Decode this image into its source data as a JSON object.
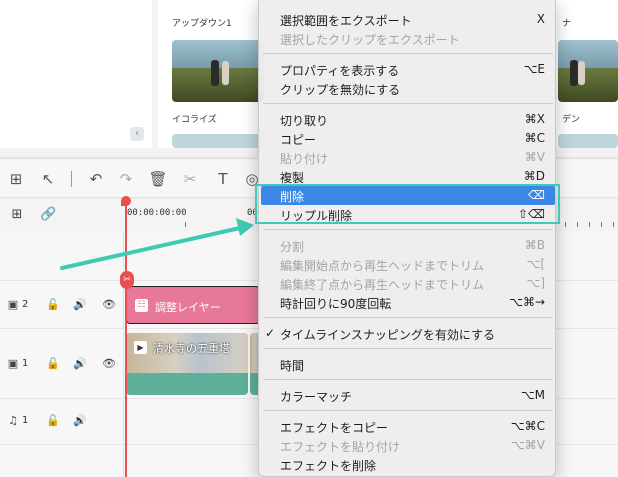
{
  "media": {
    "thumbs": [
      {
        "label": "アップダウン1"
      },
      {
        "label": "イコライズ"
      },
      {
        "label": "ナ"
      },
      {
        "label": "デン"
      }
    ],
    "collapse_glyph": "‹"
  },
  "toolbar": {
    "icons": [
      "grid-icon",
      "pointer-icon",
      "undo-icon",
      "redo-icon",
      "trash-icon",
      "scissors-icon",
      "text-icon",
      "color-icon"
    ]
  },
  "ruler": {
    "start_time": "00:00:00:00",
    "next_time": "00"
  },
  "tracks": [
    {
      "id": "2",
      "kind": "video"
    },
    {
      "id": "1",
      "kind": "video"
    },
    {
      "id": "1",
      "kind": "audio"
    }
  ],
  "clips": {
    "adjustment": "調整レイヤー",
    "video": "清水寺の五重塔"
  },
  "menu": {
    "items": [
      {
        "label": "選択範囲をエクスポート",
        "shortcut": "X",
        "disabled": false
      },
      {
        "label": "選択したクリップをエクスポート",
        "shortcut": "",
        "disabled": true
      },
      {
        "label": "プロパティを表示する",
        "shortcut": "⌥E",
        "disabled": false
      },
      {
        "label": "クリップを無効にする",
        "shortcut": "",
        "disabled": false
      },
      {
        "label": "切り取り",
        "shortcut": "⌘X",
        "disabled": false
      },
      {
        "label": "コピー",
        "shortcut": "⌘C",
        "disabled": false
      },
      {
        "label": "貼り付け",
        "shortcut": "⌘V",
        "disabled": true
      },
      {
        "label": "複製",
        "shortcut": "⌘D",
        "disabled": false
      },
      {
        "label": "削除",
        "shortcut": "⌫",
        "disabled": false
      },
      {
        "label": "リップル削除",
        "shortcut": "⇧⌫",
        "disabled": false
      },
      {
        "label": "分割",
        "shortcut": "⌘B",
        "disabled": true
      },
      {
        "label": "編集開始点から再生ヘッドまでトリム",
        "shortcut": "⌥[",
        "disabled": true
      },
      {
        "label": "編集終了点から再生ヘッドまでトリム",
        "shortcut": "⌥]",
        "disabled": true
      },
      {
        "label": "時計回りに90度回転",
        "shortcut": "⌥⌘→",
        "disabled": false
      },
      {
        "label": "タイムラインスナッピングを有効にする",
        "shortcut": "",
        "disabled": false,
        "checked": true,
        "check": "✓"
      },
      {
        "label": "時間",
        "shortcut": "",
        "disabled": false
      },
      {
        "label": "カラーマッチ",
        "shortcut": "⌥M",
        "disabled": false
      },
      {
        "label": "エフェクトをコピー",
        "shortcut": "⌥⌘C",
        "disabled": false
      },
      {
        "label": "エフェクトを貼り付け",
        "shortcut": "⌥⌘V",
        "disabled": true
      },
      {
        "label": "エフェクトを削除",
        "shortcut": "",
        "disabled": false
      }
    ]
  },
  "colors": {
    "highlight": "#3b87e6",
    "annotation": "#3fcab6",
    "playhead": "#e8504f",
    "adjustment_clip": "#e8789a",
    "video_clip": "#5eb09a"
  }
}
